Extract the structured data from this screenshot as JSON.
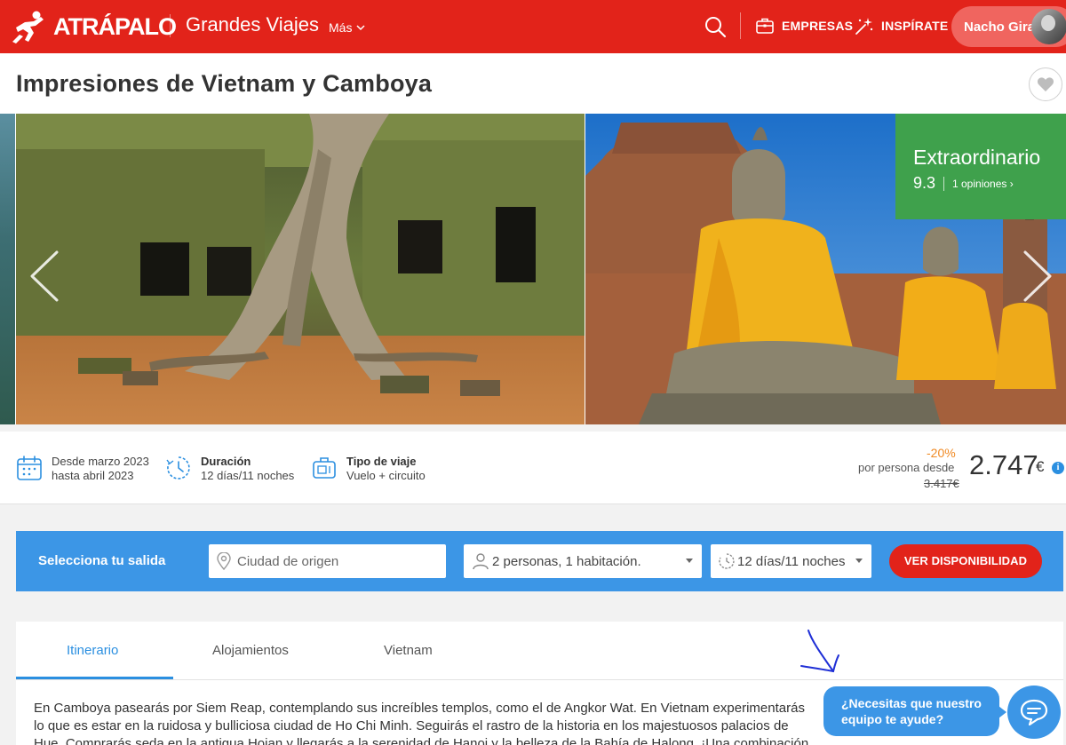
{
  "header": {
    "logo_text": "ATRÁPALO",
    "section": "Grandes Viajes",
    "more_menu": "Más",
    "empresas": "EMPRESAS",
    "inspirate": "INSPÍRATE",
    "user_name": "Nacho Giral",
    "icons": [
      "runner-logo-icon",
      "chevron-down-icon",
      "search-icon",
      "briefcase-icon",
      "sparkle-wand-icon",
      "avatar"
    ]
  },
  "page": {
    "title": "Impresiones de Vietnam y Camboya"
  },
  "gallery": {
    "images": [
      "angkor-temple-ruins-photo",
      "buddha-statues-photo"
    ],
    "rating_label": "Extraordinario",
    "rating_score": "9.3",
    "rating_count": "1 opiniones ›"
  },
  "info": {
    "dates_line1": "Desde marzo 2023",
    "dates_line2": "hasta abril 2023",
    "duration_label": "Duración",
    "duration_value": "12 días/11 noches",
    "type_label": "Tipo de viaje",
    "type_value": "Vuelo + circuito",
    "discount": "-20%",
    "per_person": "por persona desde",
    "old_price": "3.417€",
    "price": "2.747",
    "currency": "€",
    "info_glyph": "i"
  },
  "search": {
    "label": "Selecciona tu salida",
    "origin_placeholder": "Ciudad de origen",
    "people": "2 personas, 1 habitación.",
    "duration": "12 días/11 noches",
    "cta": "VER DISPONIBILIDAD"
  },
  "tabs": [
    {
      "label": "Itinerario",
      "active": true
    },
    {
      "label": "Alojamientos",
      "active": false
    },
    {
      "label": "Vietnam",
      "active": false
    }
  ],
  "description": "En Camboya pasearás por Siem Reap, contemplando sus increíbles templos, como el de Angkor Wat. En Vietnam experimentarás lo que es estar en la ruidosa y bulliciosa ciudad de Ho Chi Minh. Seguirás el rastro de la historia en los majestuosos palacios de Hue. Comprarás seda en la antigua Hoian y llegarás a la serenidad de Hanoi y la belleza de la Bahía de Halong. ¡Una combinación",
  "help": {
    "line1": "¿Necesitas que nuestro",
    "line2": "equipo te ayude?"
  },
  "colors": {
    "brand_red": "#e2231a",
    "search_blue": "#3c96e6",
    "rating_green": "#3fa14c",
    "discount_orange": "#f08a24",
    "tab_blue": "#2b8fe0"
  }
}
